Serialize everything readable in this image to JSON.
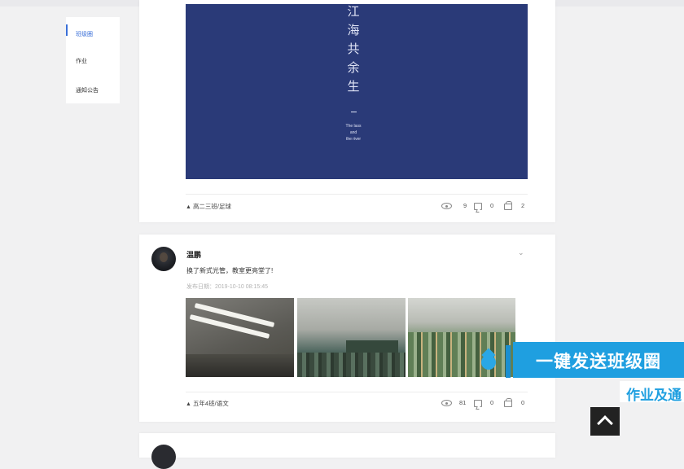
{
  "sidebar": {
    "items": [
      {
        "label": "班级圈",
        "active": true
      },
      {
        "label": "作业"
      },
      {
        "label": "通知公告"
      }
    ]
  },
  "post1": {
    "poster_vertical_text": "江海共余生",
    "poster_english": [
      "The lass",
      "and",
      "the river"
    ],
    "class_label": "高二三班/足球",
    "views": "9",
    "comments": "0",
    "gifts": "2"
  },
  "post2": {
    "username": "温鹏",
    "content": "换了新式光管，教室更亮堂了!",
    "date": "发布日期：2019-10-10 08:15:45",
    "photos": [
      "classroom ceiling lights",
      "classroom with students",
      "students in classroom"
    ],
    "class_label": "五年4班/语文",
    "views": "81",
    "comments": "0",
    "gifts": "0"
  },
  "overlay": {
    "headline": "一键发送班级圈",
    "subline": "作业及通"
  },
  "colors": {
    "accent": "#1f9fe0",
    "poster_bg": "#2a3a78",
    "nav_active": "#3a6fd8"
  },
  "icons": {
    "views": "eye-icon",
    "comments": "comment-icon",
    "gifts": "gift-icon",
    "back_to_top": "chevron-up-icon",
    "more": "chevron-down-icon"
  }
}
